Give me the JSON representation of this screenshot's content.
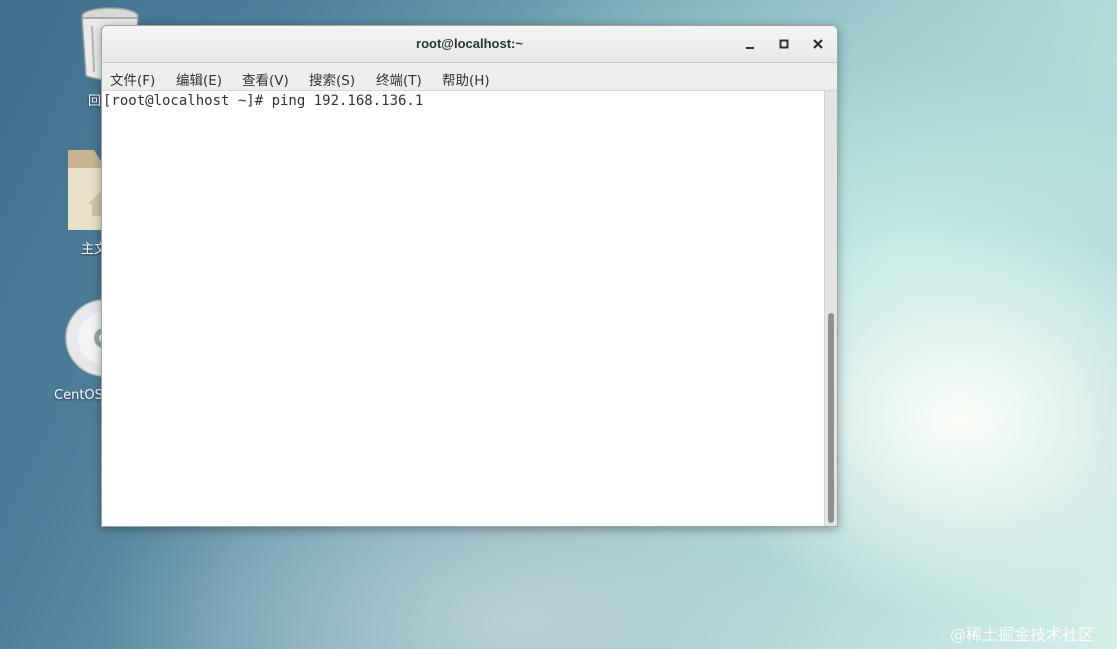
{
  "desktop": {
    "icons": [
      {
        "name": "trash",
        "label": "回",
        "icon": "trash-icon"
      },
      {
        "name": "home",
        "label": "主文",
        "icon": "folder-home-icon"
      },
      {
        "name": "cd",
        "label": "CentOS",
        "icon": "cd-icon"
      }
    ],
    "watermark": "@稀土掘金技术社区"
  },
  "window": {
    "title": "root@localhost:~",
    "controls": [
      "minimize-icon",
      "maximize-icon",
      "close-icon"
    ]
  },
  "menu": {
    "file": "文件(F)",
    "edit": "编辑(E)",
    "view": "查看(V)",
    "search": "搜索(S)",
    "terminal": "终端(T)",
    "help": "帮助(H)"
  },
  "terminal": {
    "line": "[root@localhost ~]# ping 192.168.136.1"
  },
  "colors": {
    "text": "#2e3436",
    "titlebar": "#eeeeec",
    "scrollbar_thumb": "#8e9192"
  }
}
